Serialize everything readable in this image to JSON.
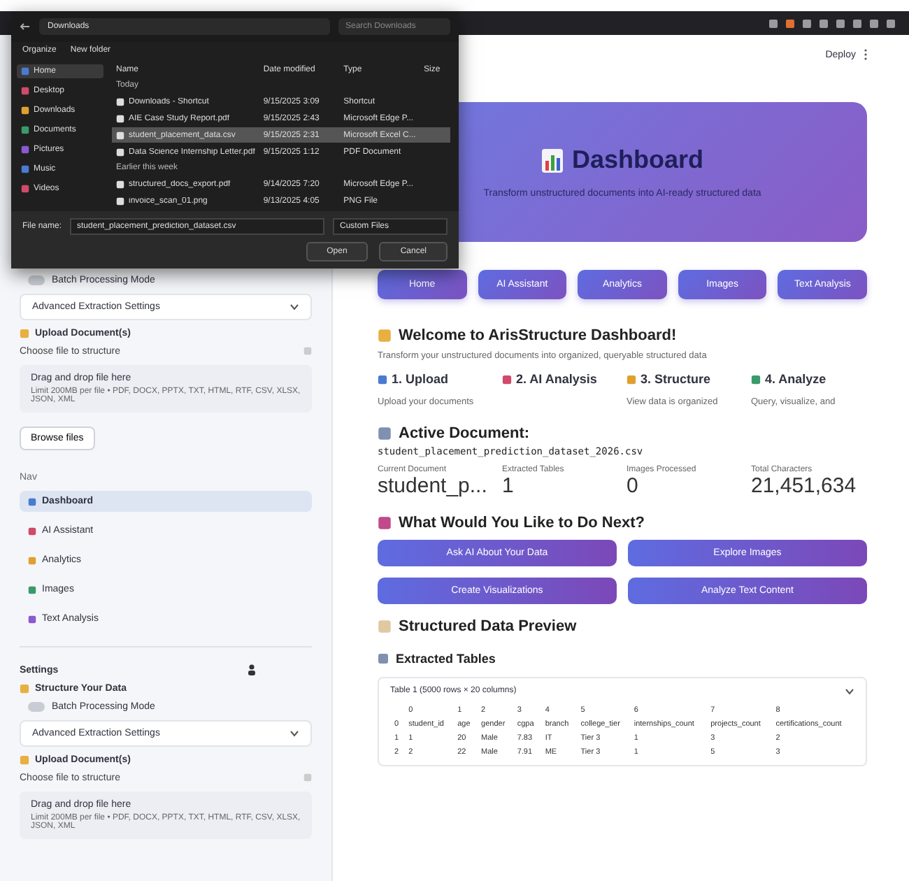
{
  "file_dialog": {
    "path": "Downloads",
    "search_placeholder": "Search Downloads",
    "menu": [
      "Organize",
      "New folder"
    ],
    "places": [
      {
        "label": "Home",
        "selected": true
      },
      {
        "label": "Desktop",
        "selected": false
      },
      {
        "label": "Downloads",
        "selected": false
      },
      {
        "label": "Documents",
        "selected": false
      },
      {
        "label": "Pictures",
        "selected": false
      },
      {
        "label": "Music",
        "selected": false
      },
      {
        "label": "Videos",
        "selected": false
      }
    ],
    "columns": [
      "Name",
      "Date modified",
      "Type",
      "Size"
    ],
    "groups": [
      {
        "label": "Today",
        "files": [
          {
            "name": "Downloads - Shortcut",
            "date": "9/15/2025 3:09",
            "type": "Shortcut",
            "selected": false
          },
          {
            "name": "AIE Case Study Report.pdf",
            "date": "9/15/2025 2:43",
            "type": "Microsoft Edge P...",
            "selected": false
          },
          {
            "name": "student_placement_data.csv",
            "date": "9/15/2025 2:31",
            "type": "Microsoft Excel C...",
            "selected": true
          },
          {
            "name": "Data Science Internship Letter.pdf",
            "date": "9/15/2025 1:12",
            "type": "PDF Document",
            "selected": false
          }
        ]
      },
      {
        "label": "Earlier this week",
        "files": [
          {
            "name": "structured_docs_export.pdf",
            "date": "9/14/2025 7:20",
            "type": "Microsoft Edge P...",
            "selected": false
          },
          {
            "name": "invoice_scan_01.png",
            "date": "9/13/2025 4:05",
            "type": "PNG File",
            "selected": false
          }
        ]
      }
    ],
    "file_name_label": "File name:",
    "file_name": "student_placement_prediction_dataset.csv",
    "filter": "Custom Files",
    "buttons": [
      "Open",
      "Cancel"
    ]
  },
  "header": {
    "deploy": "Deploy"
  },
  "sidebar": {
    "top": [
      {
        "kind": "toggle",
        "label": "Batch Processing Mode",
        "on": false
      },
      {
        "kind": "expander",
        "label": "Advanced Extraction Settings"
      },
      {
        "kind": "heading",
        "label": "Upload Document(s)"
      },
      {
        "kind": "uploader",
        "label": "Choose file to structure",
        "title": "Drag and drop file here",
        "hint": "Limit 200MB per file • PDF, DOCX, PPTX, TXT, HTML, RTF, CSV, XLSX, JSON, XML",
        "button": "Browse files"
      }
    ],
    "nav": {
      "title": "Nav",
      "items": [
        {
          "label": "Dashboard",
          "selected": true
        },
        {
          "label": "AI Assistant",
          "selected": false
        },
        {
          "label": "Analytics",
          "selected": false
        },
        {
          "label": "Images",
          "selected": false
        },
        {
          "label": "Text Analysis",
          "selected": false
        }
      ]
    },
    "settings": "Settings",
    "bottom": [
      {
        "kind": "heading",
        "label": "Structure Your Data"
      },
      {
        "kind": "toggle",
        "label": "Batch Processing Mode",
        "on": false
      },
      {
        "kind": "expander",
        "label": "Advanced Extraction Settings"
      },
      {
        "kind": "heading",
        "label": "Upload Document(s)"
      },
      {
        "kind": "uploader",
        "label": "Choose file to structure",
        "title": "Drag and drop file here",
        "hint": "Limit 200MB per file • PDF, DOCX, PPTX, TXT, HTML, RTF, CSV, XLSX, JSON, XML"
      }
    ]
  },
  "hero": {
    "title": "Dashboard",
    "subtitle": "Transform unstructured documents into AI-ready structured data"
  },
  "nav_buttons": [
    "Home",
    "AI Assistant",
    "Analytics",
    "Images",
    "Text Analysis"
  ],
  "welcome": {
    "title": "Welcome to ArisStructure Dashboard!",
    "subtitle": "Transform your unstructured documents into organized, queryable structured data",
    "steps": [
      {
        "title": "1. Upload",
        "text": "Upload your documents"
      },
      {
        "title": "2. AI Analysis"
      },
      {
        "title": "3. Structure",
        "text": "View data is organized"
      },
      {
        "title": "4. Analyze",
        "text": "Query, visualize, and"
      }
    ]
  },
  "active_document": {
    "title": "Active Document:",
    "file": "student_placement_prediction_dataset_2026.csv",
    "metrics": [
      {
        "label": "Current Document",
        "value": "student_p..."
      },
      {
        "label": "Extracted Tables",
        "value": "1"
      },
      {
        "label": "Images Processed",
        "value": "0"
      },
      {
        "label": "Total Characters",
        "value": "21,451,634"
      }
    ]
  },
  "next": {
    "title": "What Would You Like to Do Next?",
    "buttons": [
      "Ask AI About Your Data",
      "Explore Images",
      "Create Visualizations",
      "Analyze Text Content"
    ]
  },
  "preview": {
    "title": "Structured Data Preview",
    "subtitle": "Extracted Tables",
    "expander": "Table 1 (5000 rows × 20 columns)",
    "columns": [
      "",
      "0",
      "1",
      "2",
      "3",
      "4",
      "5",
      "6",
      "7",
      "8"
    ],
    "rows": [
      [
        "0",
        "student_id",
        "age",
        "gender",
        "cgpa",
        "branch",
        "college_tier",
        "internships_count",
        "projects_count",
        "certifications_count"
      ],
      [
        "1",
        "1",
        "20",
        "Male",
        "7.83",
        "IT",
        "Tier 3",
        "1",
        "3",
        "2"
      ],
      [
        "2",
        "2",
        "22",
        "Male",
        "7.91",
        "ME",
        "Tier 3",
        "1",
        "5",
        "3"
      ]
    ]
  }
}
